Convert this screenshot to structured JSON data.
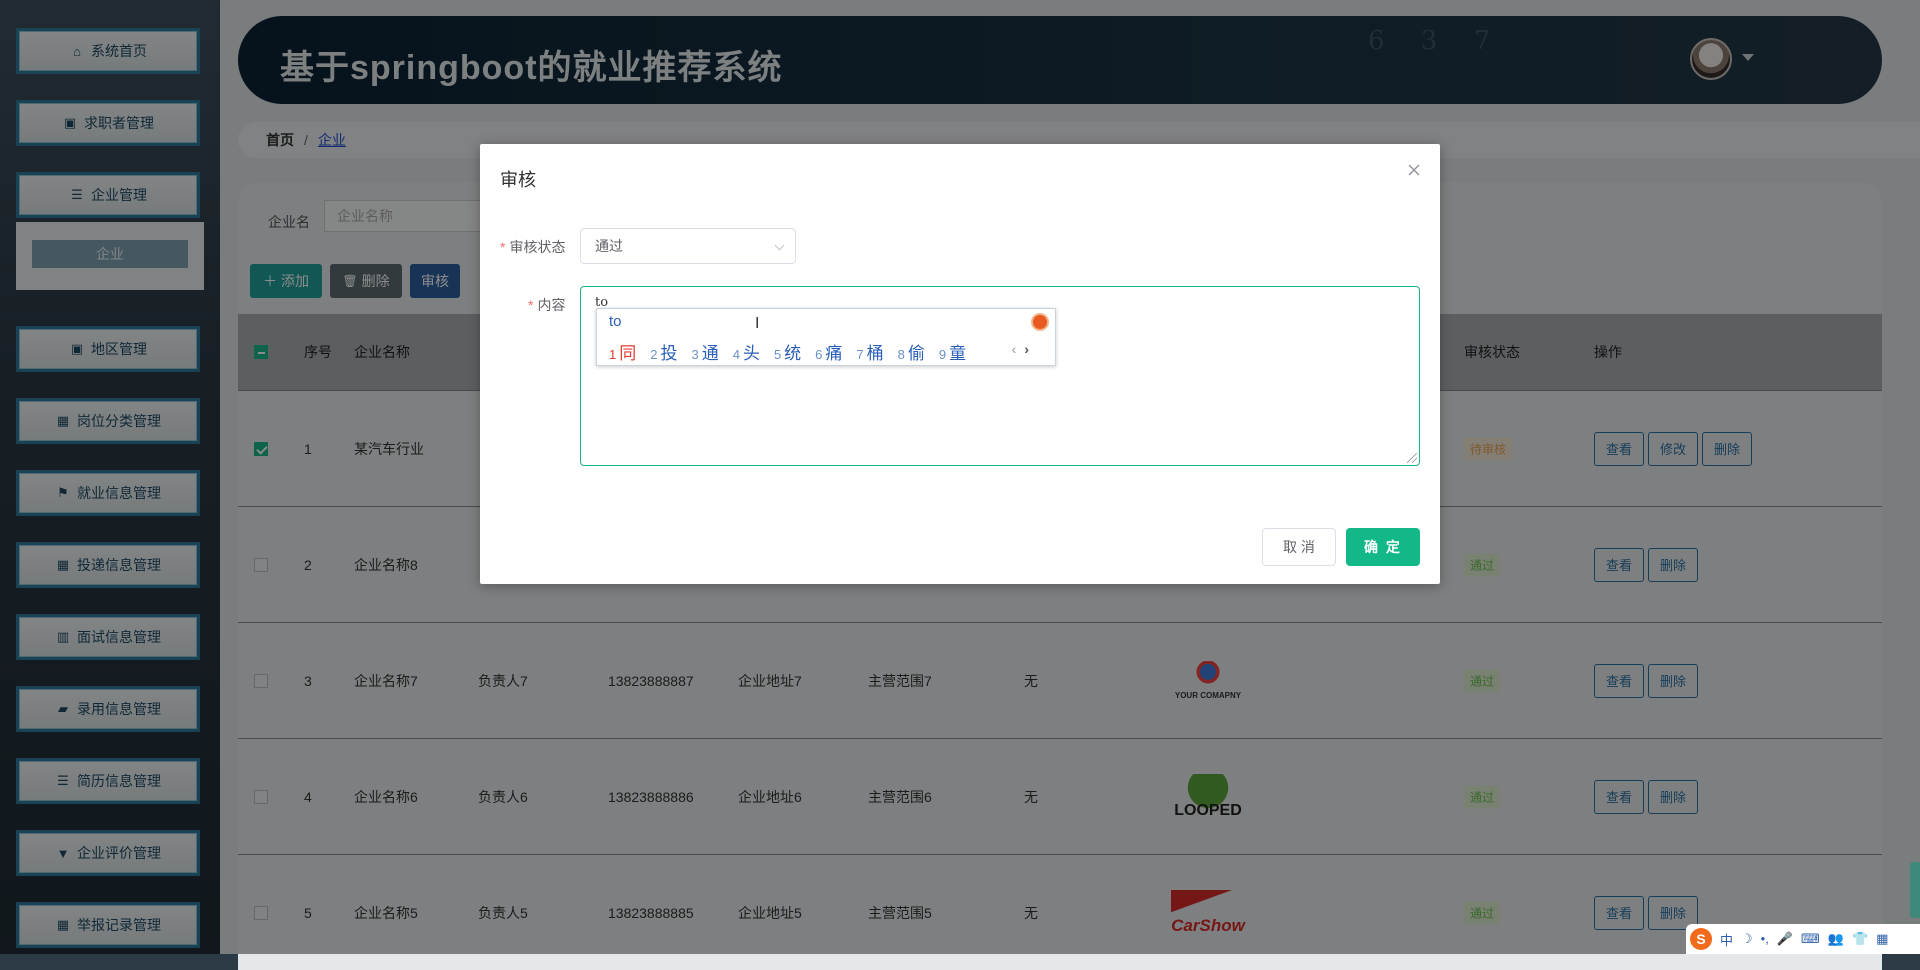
{
  "app_title": "基于springboot的就业推荐系统",
  "header": {
    "deco_numbers": "6 3 7"
  },
  "sidebar": {
    "items": [
      {
        "label": "系统首页",
        "icon": "home-icon",
        "glyph": "⌂"
      },
      {
        "label": "求职者管理",
        "icon": "clipboard-icon",
        "glyph": "▣"
      },
      {
        "label": "企业管理",
        "icon": "list-icon",
        "glyph": "☰"
      },
      {
        "label": "地区管理",
        "icon": "clipboard-icon",
        "glyph": "▣"
      },
      {
        "label": "岗位分类管理",
        "icon": "grid-icon",
        "glyph": "▦"
      },
      {
        "label": "就业信息管理",
        "icon": "flag-icon",
        "glyph": "⚑"
      },
      {
        "label": "投递信息管理",
        "icon": "grid-icon",
        "glyph": "▦"
      },
      {
        "label": "面试信息管理",
        "icon": "chart-icon",
        "glyph": "▥"
      },
      {
        "label": "录用信息管理",
        "icon": "ticket-icon",
        "glyph": "▰"
      },
      {
        "label": "简历信息管理",
        "icon": "list-icon",
        "glyph": "☰"
      },
      {
        "label": "企业评价管理",
        "icon": "cup-icon",
        "glyph": "▼"
      },
      {
        "label": "举报记录管理",
        "icon": "grid-icon",
        "glyph": "▦"
      }
    ],
    "submenu": {
      "label": "企业"
    }
  },
  "breadcrumb": {
    "home": "首页",
    "separator": "/",
    "current": "企业"
  },
  "search": {
    "label": "企业名",
    "placeholder": "企业名称"
  },
  "toolbar": {
    "add_label": "添加",
    "delete_label": "删除",
    "audit_label": "审核"
  },
  "table": {
    "headers": {
      "index": "序号",
      "name": "企业名称",
      "status": "审核状态",
      "actions": "操作"
    },
    "rows": [
      {
        "index": "1",
        "name": "某汽车行业",
        "contact": "",
        "phone": "",
        "address": "",
        "scope": "",
        "remark": "",
        "logo": "",
        "status": "待审核",
        "status_type": "wait",
        "checked": true,
        "actions": [
          "查看",
          "修改",
          "删除"
        ]
      },
      {
        "index": "2",
        "name": "企业名称8",
        "contact": "",
        "phone": "",
        "address": "",
        "scope": "",
        "remark": "",
        "logo": "",
        "status": "通过",
        "status_type": "pass",
        "checked": false,
        "actions": [
          "查看",
          "删除"
        ]
      },
      {
        "index": "3",
        "name": "企业名称7",
        "contact": "负责人7",
        "phone": "13823888887",
        "address": "企业地址7",
        "scope": "主营范围7",
        "remark": "无",
        "logo": "YOUR COMAPNY",
        "status": "通过",
        "status_type": "pass",
        "checked": false,
        "actions": [
          "查看",
          "删除"
        ]
      },
      {
        "index": "4",
        "name": "企业名称6",
        "contact": "负责人6",
        "phone": "13823888886",
        "address": "企业地址6",
        "scope": "主营范围6",
        "remark": "无",
        "logo": "LOOPED",
        "status": "通过",
        "status_type": "pass",
        "checked": false,
        "actions": [
          "查看",
          "删除"
        ]
      },
      {
        "index": "5",
        "name": "企业名称5",
        "contact": "负责人5",
        "phone": "13823888885",
        "address": "企业地址5",
        "scope": "主营范围5",
        "remark": "无",
        "logo": "CarShow",
        "status": "通过",
        "status_type": "pass",
        "checked": false,
        "actions": [
          "查看",
          "删除"
        ]
      }
    ]
  },
  "dialog": {
    "title": "审核",
    "status_label": "审核状态",
    "status_value": "通过",
    "content_label": "内容",
    "content_value": "to",
    "cancel_label": "取 消",
    "ok_label": "确 定"
  },
  "ime": {
    "composition": "to",
    "candidates": [
      {
        "n": "1",
        "c": "同"
      },
      {
        "n": "2",
        "c": "投"
      },
      {
        "n": "3",
        "c": "通"
      },
      {
        "n": "4",
        "c": "头"
      },
      {
        "n": "5",
        "c": "统"
      },
      {
        "n": "6",
        "c": "痛"
      },
      {
        "n": "7",
        "c": "桶"
      },
      {
        "n": "8",
        "c": "偷"
      },
      {
        "n": "9",
        "c": "童"
      }
    ],
    "prev": "‹",
    "next": "›"
  },
  "tray": {
    "logo": "S",
    "lang": "中",
    "items": [
      "☽",
      "•,",
      "🎤",
      "⌨",
      "👥",
      "👕",
      "▦"
    ]
  }
}
